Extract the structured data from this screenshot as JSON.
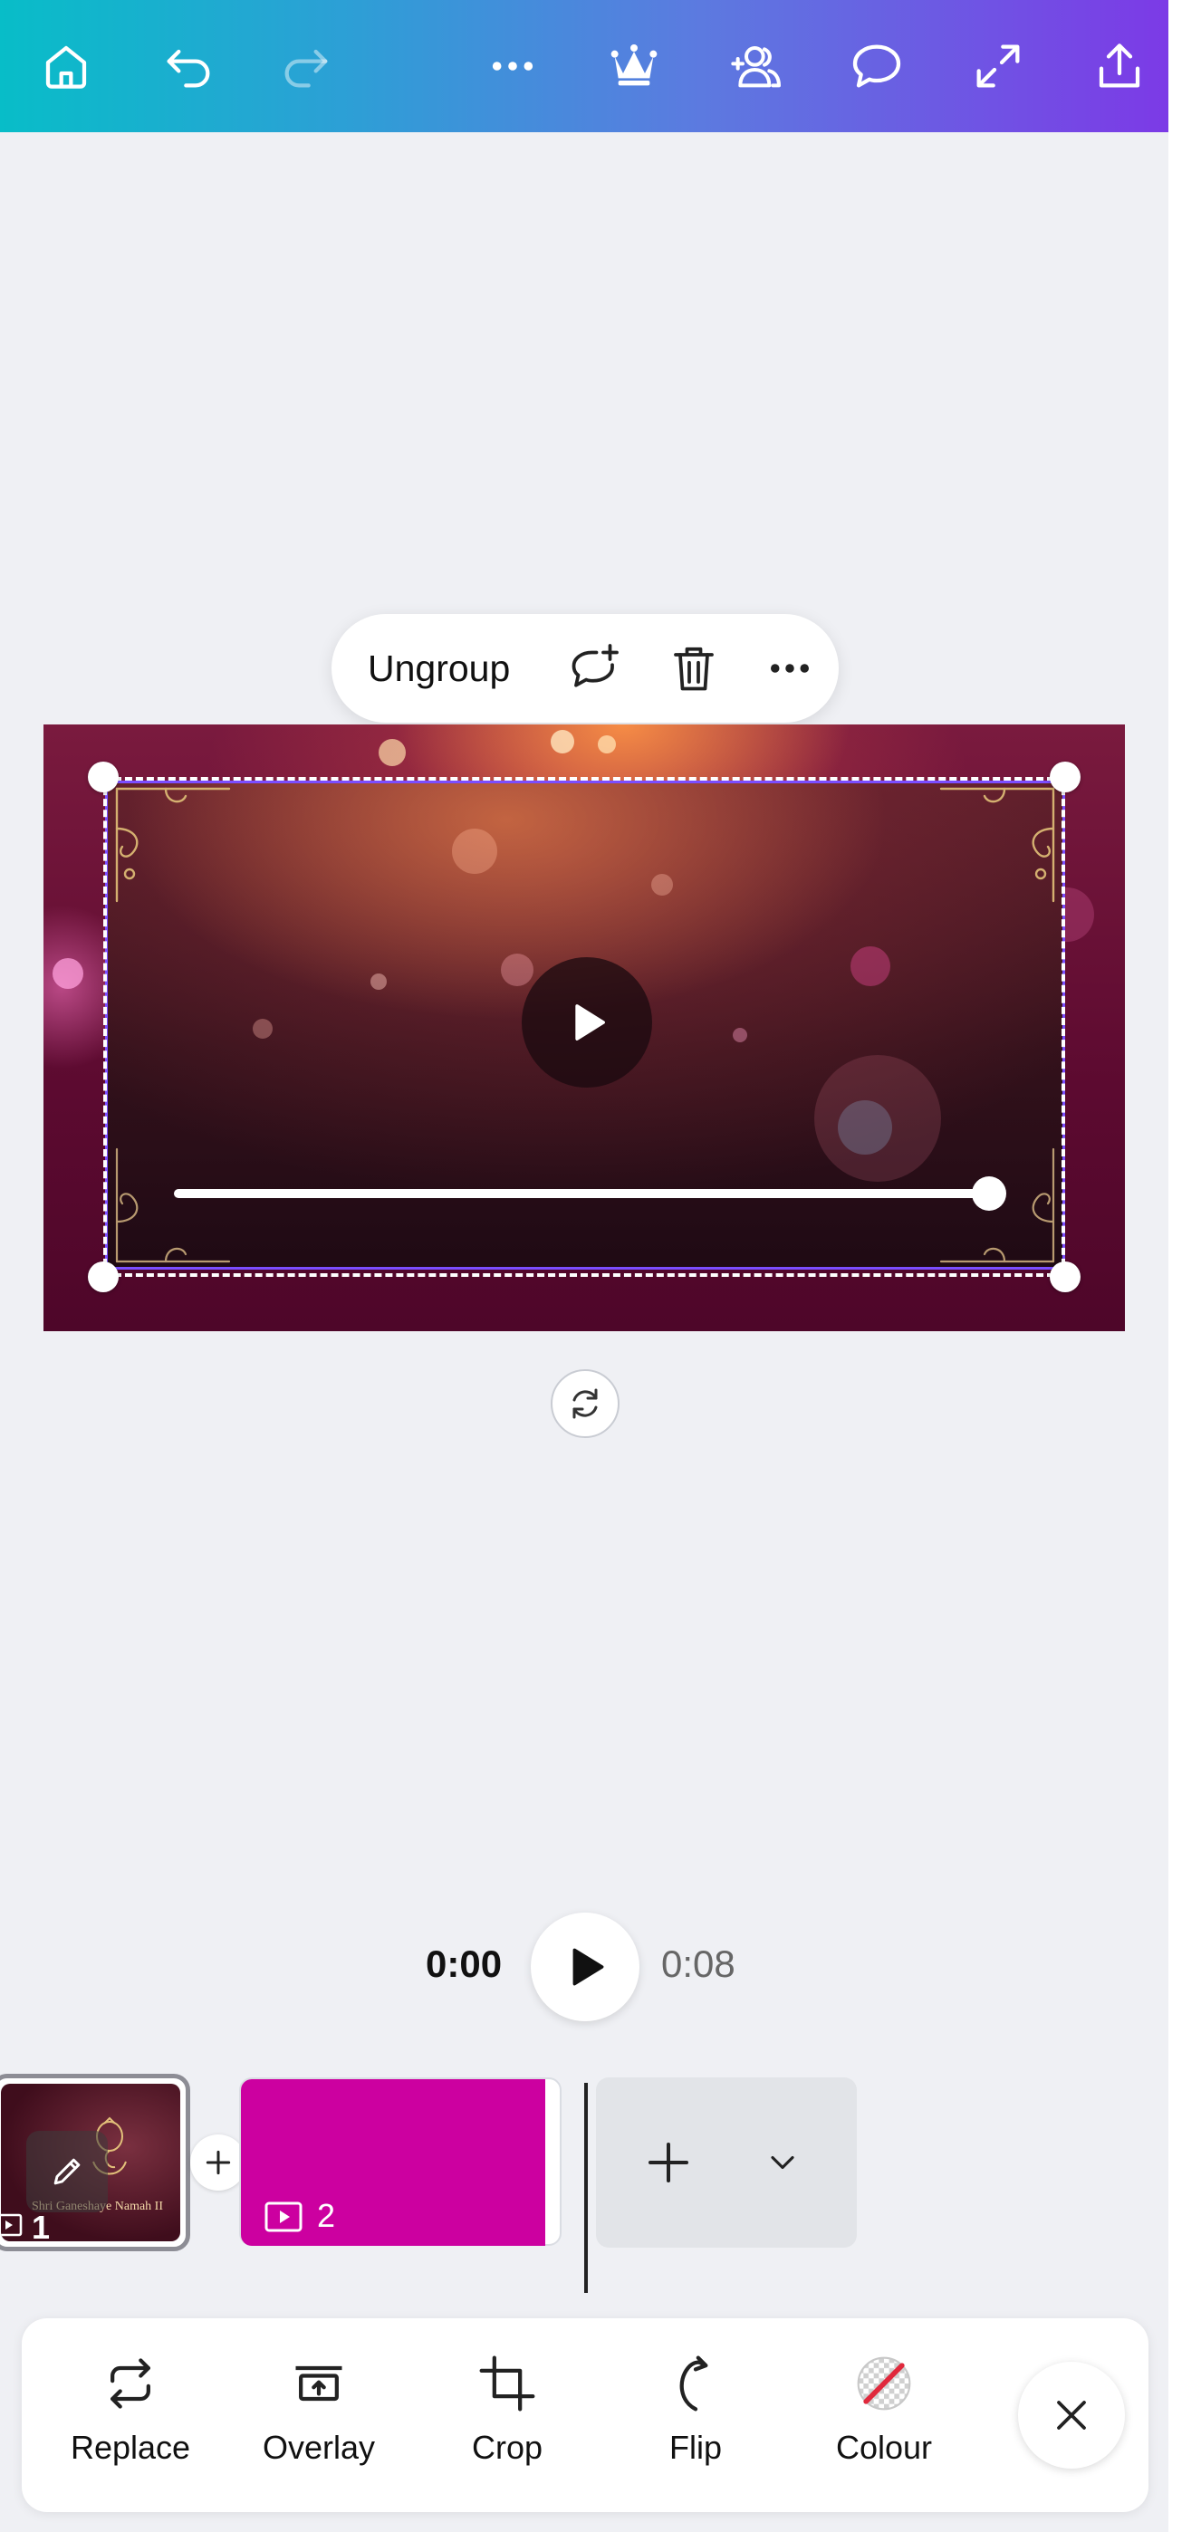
{
  "topbar": {
    "icons": [
      "home-icon",
      "undo-icon",
      "redo-icon",
      "more-icon",
      "crown-icon",
      "add-people-icon",
      "comment-icon",
      "fullscreen-icon",
      "share-icon"
    ]
  },
  "context_toolbar": {
    "ungroup_label": "Ungroup",
    "icons": [
      "add-comment-icon",
      "trash-icon",
      "more-icon"
    ]
  },
  "canvas": {
    "video_progress": 1.0
  },
  "playback": {
    "current_time": "0:00",
    "duration": "0:08"
  },
  "timeline": {
    "clips": [
      {
        "number": "1",
        "caption": "Shri Ganeshaye Namah II",
        "color": "#3f0d1c"
      },
      {
        "number": "2",
        "color": "#cc00a0"
      }
    ]
  },
  "bottom_toolbar": {
    "items": [
      {
        "label": "Replace",
        "icon": "replace-icon"
      },
      {
        "label": "Overlay",
        "icon": "overlay-icon"
      },
      {
        "label": "Crop",
        "icon": "crop-icon"
      },
      {
        "label": "Flip",
        "icon": "flip-icon"
      },
      {
        "label": "Colour",
        "icon": "colour-icon"
      }
    ]
  },
  "colors": {
    "topbar_start": "#08bdc8",
    "topbar_end": "#7c3ae6",
    "selection_accent": "#7b4dff",
    "colour_swatch_line": "#e0283c"
  }
}
